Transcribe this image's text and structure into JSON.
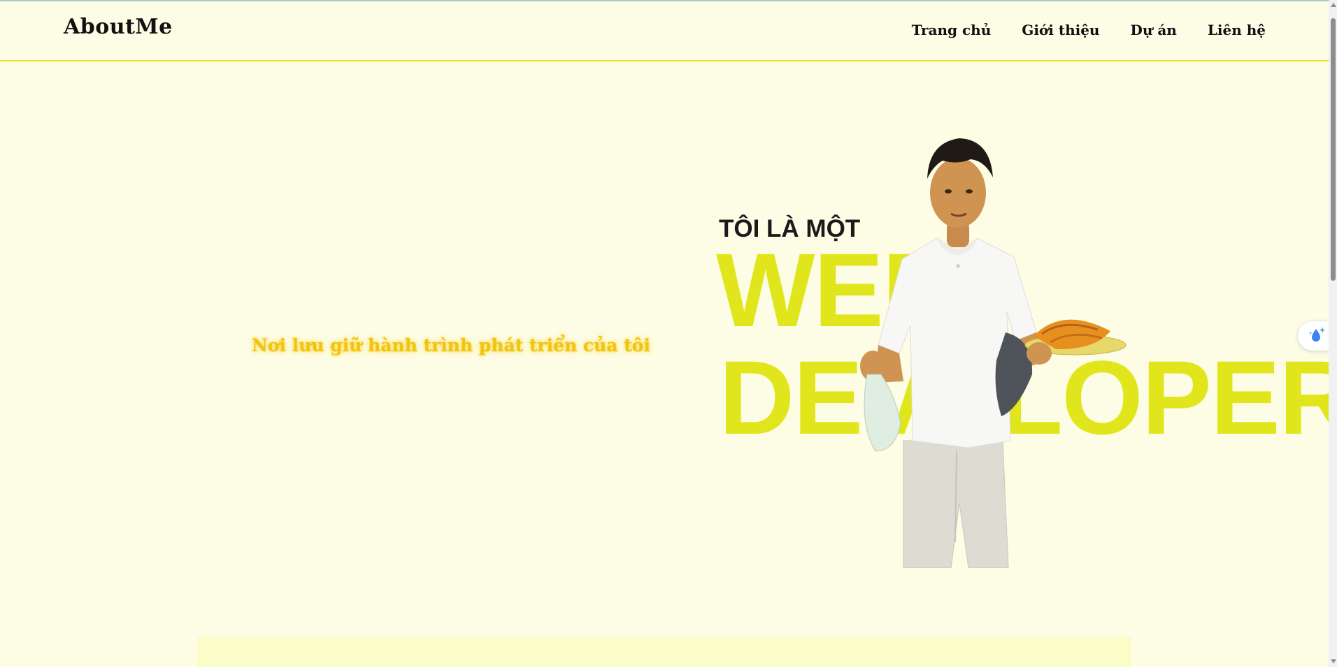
{
  "brand": {
    "name": "AboutMe"
  },
  "nav": {
    "items": [
      {
        "label": "Trang chủ"
      },
      {
        "label": "Giới thiệu"
      },
      {
        "label": "Dự án"
      },
      {
        "label": "Liên hệ"
      }
    ]
  },
  "hero": {
    "tagline": "Nơi lưu giữ hành trình phát triển của tôi",
    "intro": "TÔI LÀ MỘT",
    "title_line1": "WEB",
    "title_line2": "DEVELOPER"
  },
  "colors": {
    "background": "#fdfde6",
    "accent": "#e1e61c",
    "tagline": "#f2c40f",
    "nav_border": "#e6e51f"
  },
  "icons": {
    "floating_widget": "sparkle-drop-icon"
  }
}
